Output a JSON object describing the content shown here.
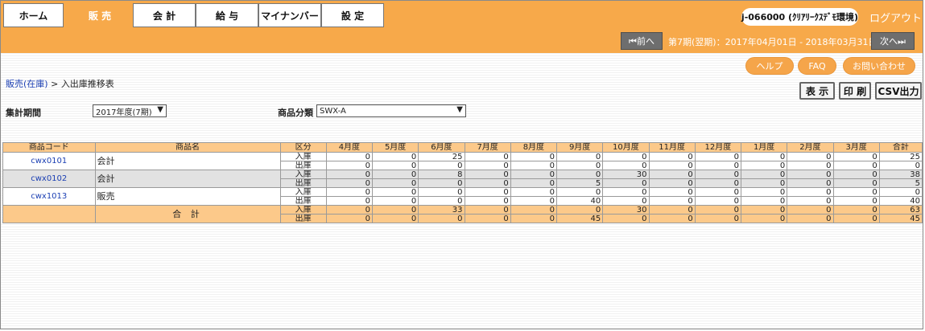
{
  "nav": {
    "tabs": [
      {
        "label": "ホーム",
        "active": false
      },
      {
        "label": "販 売",
        "active": true
      },
      {
        "label": "会 計",
        "active": false
      },
      {
        "label": "給 与",
        "active": false
      },
      {
        "label": "マイナンバー",
        "active": false
      },
      {
        "label": "設 定",
        "active": false
      }
    ],
    "account": "j-066000 (ｸﾘｱﾘｰｸｽﾃﾞﾓ環境)",
    "logout": "ログアウト"
  },
  "period_bar": {
    "prev": "⏮前へ",
    "period_text": "第7期(翌期)：2017年04月01日 - 2018年03月31日",
    "next": "次へ⏭"
  },
  "help_buttons": {
    "help": "ヘルプ",
    "faq": "FAQ",
    "contact": "お問い合わせ"
  },
  "breadcrumb": {
    "parent": "販売(在庫)",
    "separator": " > ",
    "current": "入出庫推移表"
  },
  "actions": {
    "show": "表 示",
    "print": "印 刷",
    "csv": "CSV出力"
  },
  "filters": {
    "period_label": "集計期間",
    "period_value": "2017年度(7期)",
    "category_label": "商品分類",
    "category_value": "SWX-A"
  },
  "table": {
    "headers": [
      "商品コード",
      "商品名",
      "区分",
      "4月度",
      "5月度",
      "6月度",
      "7月度",
      "8月度",
      "9月度",
      "10月度",
      "11月度",
      "12月度",
      "1月度",
      "2月度",
      "3月度",
      "合計"
    ],
    "in_label": "入庫",
    "out_label": "出庫",
    "products": [
      {
        "code": "cwx0101",
        "name": "会計",
        "in": [
          "0",
          "0",
          "25",
          "0",
          "0",
          "0",
          "0",
          "0",
          "0",
          "0",
          "0",
          "0",
          "25"
        ],
        "out": [
          "0",
          "0",
          "0",
          "0",
          "0",
          "0",
          "0",
          "0",
          "0",
          "0",
          "0",
          "0",
          "0"
        ]
      },
      {
        "code": "cwx0102",
        "name": "会計",
        "in": [
          "0",
          "0",
          "8",
          "0",
          "0",
          "0",
          "30",
          "0",
          "0",
          "0",
          "0",
          "0",
          "38"
        ],
        "out": [
          "0",
          "0",
          "0",
          "0",
          "0",
          "5",
          "0",
          "0",
          "0",
          "0",
          "0",
          "0",
          "5"
        ]
      },
      {
        "code": "cwx1013",
        "name": "販売",
        "in": [
          "0",
          "0",
          "0",
          "0",
          "0",
          "0",
          "0",
          "0",
          "0",
          "0",
          "0",
          "0",
          "0"
        ],
        "out": [
          "0",
          "0",
          "0",
          "0",
          "0",
          "40",
          "0",
          "0",
          "0",
          "0",
          "0",
          "0",
          "40"
        ]
      }
    ],
    "total": {
      "label": "合 計",
      "in": [
        "0",
        "0",
        "33",
        "0",
        "0",
        "0",
        "30",
        "0",
        "0",
        "0",
        "0",
        "0",
        "63"
      ],
      "out": [
        "0",
        "0",
        "0",
        "0",
        "0",
        "45",
        "0",
        "0",
        "0",
        "0",
        "0",
        "0",
        "45"
      ]
    }
  }
}
